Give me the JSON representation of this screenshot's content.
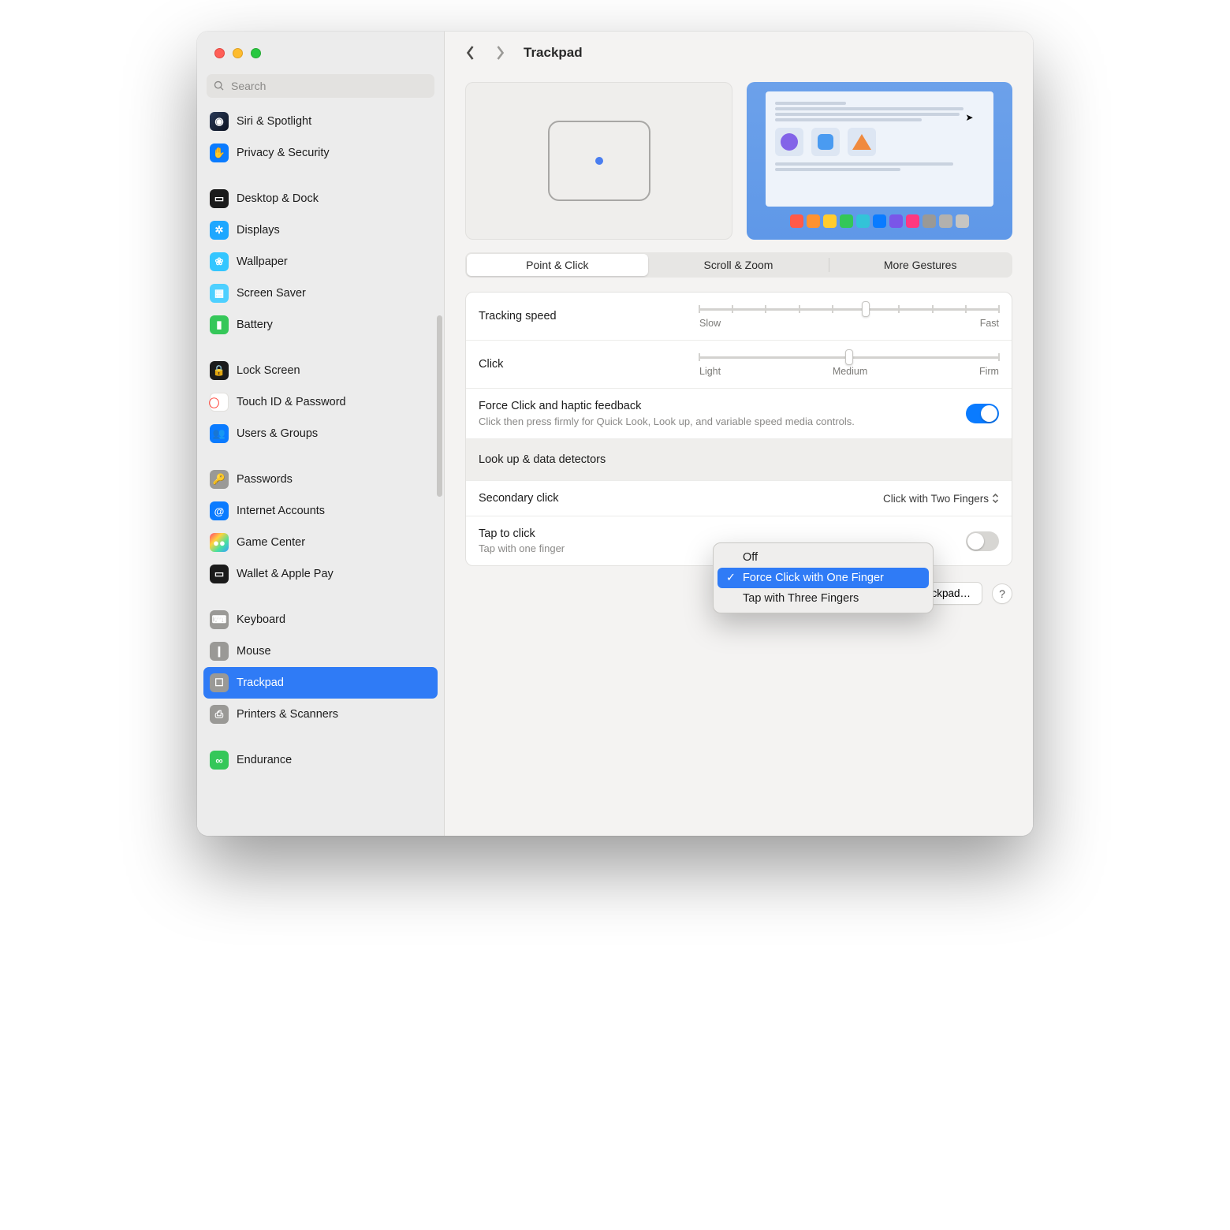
{
  "search": {
    "placeholder": "Search"
  },
  "header": {
    "title": "Trackpad"
  },
  "sidebar": {
    "items": [
      {
        "label": "Siri & Spotlight",
        "iconBg": "linear-gradient(135deg,#2a3a58,#0c1220)",
        "glyph": "◉"
      },
      {
        "label": "Privacy & Security",
        "iconBg": "#0a7bff",
        "glyph": "✋"
      },
      {
        "gap": true
      },
      {
        "label": "Desktop & Dock",
        "iconBg": "#1b1b1b",
        "glyph": "▭"
      },
      {
        "label": "Displays",
        "iconBg": "#1ea7ff",
        "glyph": "✲"
      },
      {
        "label": "Wallpaper",
        "iconBg": "#34c6ff",
        "glyph": "❀"
      },
      {
        "label": "Screen Saver",
        "iconBg": "#4ed0ff",
        "glyph": "▦"
      },
      {
        "label": "Battery",
        "iconBg": "#35c759",
        "glyph": "▮"
      },
      {
        "gap": true
      },
      {
        "label": "Lock Screen",
        "iconBg": "#1b1b1b",
        "glyph": "🔒"
      },
      {
        "label": "Touch ID & Password",
        "iconBg": "#ffffff",
        "glyph": "⃝",
        "glyphColor": "#ff3b30",
        "border": "#e3e1de"
      },
      {
        "label": "Users & Groups",
        "iconBg": "#0a7bff",
        "glyph": "👥"
      },
      {
        "gap": true
      },
      {
        "label": "Passwords",
        "iconBg": "#9a9996",
        "glyph": "🔑"
      },
      {
        "label": "Internet Accounts",
        "iconBg": "#0a7bff",
        "glyph": "@"
      },
      {
        "label": "Game Center",
        "iconBg": "linear-gradient(135deg,#ff4373,#ffd23b,#47e0a0,#3b9dff)",
        "glyph": "●●"
      },
      {
        "label": "Wallet & Apple Pay",
        "iconBg": "#1b1b1b",
        "glyph": "▭"
      },
      {
        "gap": true
      },
      {
        "label": "Keyboard",
        "iconBg": "#9a9996",
        "glyph": "⌨"
      },
      {
        "label": "Mouse",
        "iconBg": "#9a9996",
        "glyph": "❙"
      },
      {
        "label": "Trackpad",
        "iconBg": "#9a9996",
        "glyph": "☐",
        "selected": true
      },
      {
        "label": "Printers & Scanners",
        "iconBg": "#9a9996",
        "glyph": "⎙"
      },
      {
        "gap": true
      },
      {
        "label": "Endurance",
        "iconBg": "#35c759",
        "glyph": "∞"
      }
    ]
  },
  "tabs": {
    "items": [
      "Point & Click",
      "Scroll & Zoom",
      "More Gestures"
    ],
    "activeIndex": 0
  },
  "settings": {
    "tracking": {
      "label": "Tracking speed",
      "min": "Slow",
      "max": "Fast",
      "ticks": 10,
      "valueIndex": 5
    },
    "click": {
      "label": "Click",
      "min": "Light",
      "mid": "Medium",
      "max": "Firm",
      "ticks": 3,
      "valueIndex": 1
    },
    "forceClick": {
      "label": "Force Click and haptic feedback",
      "sub": "Click then press firmly for Quick Look, Look up, and variable speed media controls.",
      "on": true
    },
    "lookup": {
      "label": "Look up & data detectors",
      "options": [
        "Off",
        "Force Click with One Finger",
        "Tap with Three Fingers"
      ],
      "selectedIndex": 1
    },
    "secondary": {
      "label": "Secondary click",
      "valueText": "Click with Two Fingers"
    },
    "tapToClick": {
      "label": "Tap to click",
      "sub": "Tap with one finger",
      "on": false
    }
  },
  "footer": {
    "setup": "Set Up Bluetooth Trackpad…",
    "help": "?"
  }
}
